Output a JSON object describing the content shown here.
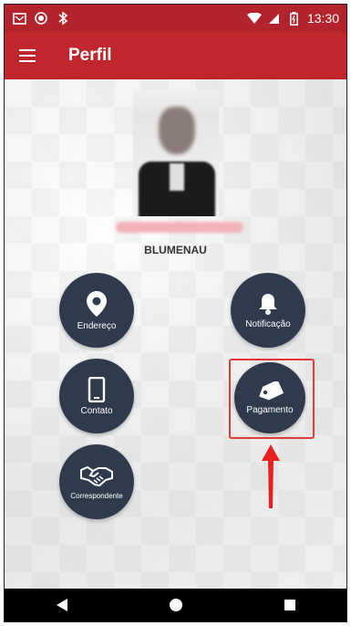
{
  "status_bar": {
    "time": "13:30",
    "left_icons": [
      "message-icon",
      "record-icon",
      "bluetooth-icon"
    ],
    "right_icons": [
      "wifi-icon",
      "signal-icon",
      "battery-icon"
    ]
  },
  "app_bar": {
    "title": "Perfil",
    "menu_icon": "hamburger-menu-icon"
  },
  "profile": {
    "city": "BLUMENAU"
  },
  "actions": {
    "endereco": {
      "label": "Endereço",
      "icon": "location-pin-icon"
    },
    "notificacao": {
      "label": "Notificação",
      "icon": "bell-icon"
    },
    "contato": {
      "label": "Contato",
      "icon": "phone-icon"
    },
    "pagamento": {
      "label": "Pagamento",
      "icon": "tag-icon"
    },
    "correspondente": {
      "label": "Correspondente",
      "icon": "handshake-icon"
    }
  },
  "colors": {
    "status_bar": "#b3232b",
    "app_bar": "#c0272d",
    "action_button": "#2f3a4d",
    "highlight": "#e03a3a"
  },
  "nav_bar": {
    "icons": [
      "back-icon",
      "home-icon",
      "recents-icon"
    ]
  }
}
